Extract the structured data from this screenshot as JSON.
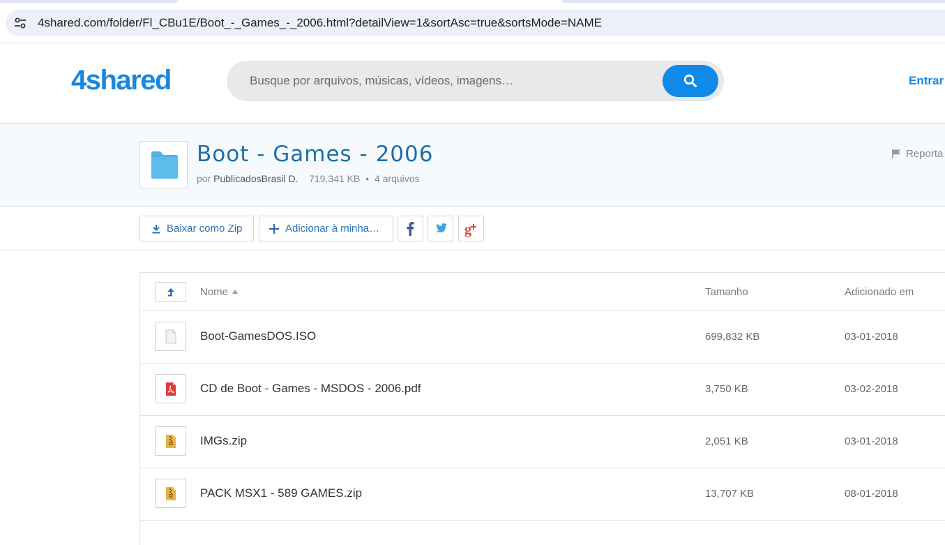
{
  "browser": {
    "url": "4shared.com/folder/Fl_CBu1E/Boot_-_Games_-_2006.html?detailView=1&sortAsc=true&sortsMode=NAME"
  },
  "header": {
    "logo": "4shared",
    "search_placeholder": "Busque por arquivos, músicas, vídeos, imagens…",
    "login_label": "Entrar"
  },
  "folder": {
    "title": "Boot - Games - 2006",
    "by_label": "por",
    "owner": "PublicadosBrasil D.",
    "size": "719,341 KB",
    "separator": "•",
    "file_count": "4 arquivos",
    "report_label": "Reporta"
  },
  "toolbar": {
    "zip_label": "Baixar como Zip",
    "add_label": "Adicionar à minha…"
  },
  "table": {
    "columns": {
      "name": "Nome",
      "size": "Tamanho",
      "date": "Adicionado em"
    },
    "rows": [
      {
        "name": "Boot-GamesDOS.ISO",
        "size": "699,832 KB",
        "date": "03-01-2018",
        "icon": "generic-file-icon"
      },
      {
        "name": "CD de Boot - Games - MSDOS - 2006.pdf",
        "size": "3,750 KB",
        "date": "03-02-2018",
        "icon": "pdf-file-icon"
      },
      {
        "name": "IMGs.zip",
        "size": "2,051 KB",
        "date": "03-01-2018",
        "icon": "zip-file-icon"
      },
      {
        "name": "PACK MSX1 - 589 GAMES.zip",
        "size": "13,707 KB",
        "date": "08-01-2018",
        "icon": "zip-file-icon"
      }
    ]
  },
  "colors": {
    "brand_blue": "#1a87dc",
    "search_button": "#0f8ae8",
    "folder_title": "#1e6fa8",
    "folder_icon": "#4fb3e8"
  }
}
